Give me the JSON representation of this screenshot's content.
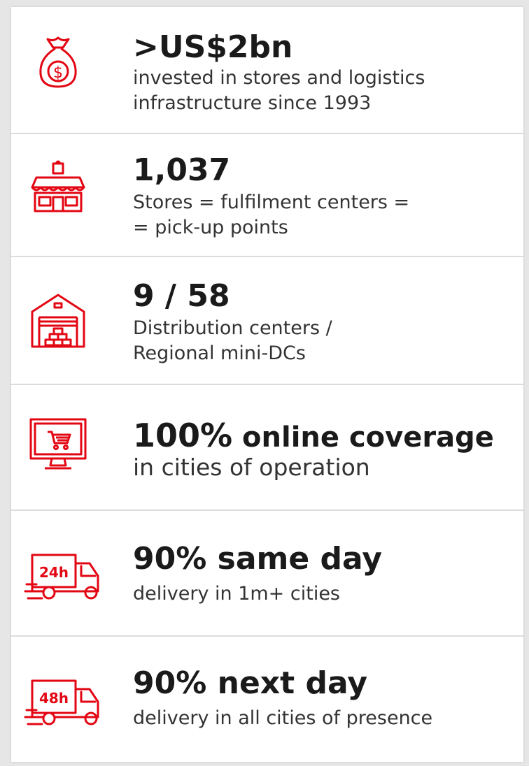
{
  "accent_color": "#e30613",
  "items": [
    {
      "icon": "money-bag-icon",
      "headline": ">US$2bn",
      "lines": [
        "invested in stores and logistics",
        "infrastructure since 1993"
      ]
    },
    {
      "icon": "store-icon",
      "headline": "1,037",
      "lines": [
        "Stores = fulfilment centers =",
        "= pick-up points"
      ]
    },
    {
      "icon": "warehouse-icon",
      "headline": "9 / 58",
      "lines": [
        "Distribution centers /",
        "Regional mini-DCs"
      ]
    },
    {
      "icon": "online-shop-monitor-icon",
      "headline_big": "100%",
      "headline_rest": " online coverage",
      "lines": [
        "in cities of operation"
      ]
    },
    {
      "icon": "delivery-truck-24h-icon",
      "icon_label": "24h",
      "headline": "90% same day",
      "lines": [
        "delivery in 1m+ cities"
      ]
    },
    {
      "icon": "delivery-truck-48h-icon",
      "icon_label": "48h",
      "headline": "90% next day",
      "lines": [
        "delivery in all cities of presence"
      ]
    }
  ]
}
